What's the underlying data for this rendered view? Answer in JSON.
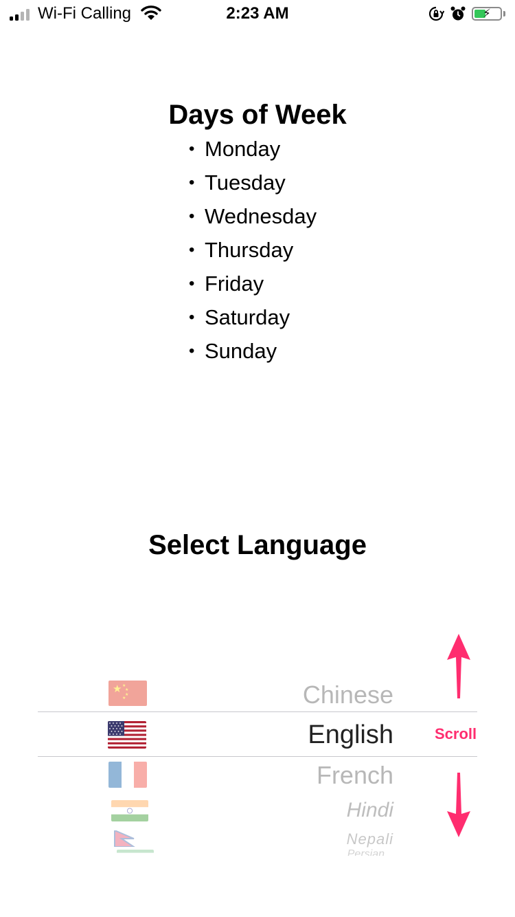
{
  "status_bar": {
    "carrier": "Wi-Fi Calling",
    "time": "2:23 AM",
    "icons": [
      "signal-icon",
      "wifi-icon",
      "orientation-lock-icon",
      "alarm-icon",
      "battery-charging-icon"
    ],
    "battery_color": "#34c759"
  },
  "days": {
    "title": "Days of Week",
    "items": [
      "Monday",
      "Tuesday",
      "Wednesday",
      "Thursday",
      "Friday",
      "Saturday",
      "Sunday"
    ]
  },
  "language": {
    "title": "Select Language",
    "options": [
      {
        "label": "Chinese",
        "flag": "china-flag-icon"
      },
      {
        "label": "English",
        "flag": "usa-flag-icon",
        "selected": true
      },
      {
        "label": "French",
        "flag": "france-flag-icon"
      },
      {
        "label": "Hindi",
        "flag": "india-flag-icon"
      },
      {
        "label": "Nepali",
        "flag": "nepal-flag-icon"
      },
      {
        "label": "Persian",
        "flag": "iran-flag-icon"
      }
    ],
    "selected": "English"
  },
  "annotation": {
    "label": "Scroll",
    "color": "#ff2d6f",
    "icons": [
      "arrow-up-icon",
      "arrow-down-icon"
    ]
  }
}
